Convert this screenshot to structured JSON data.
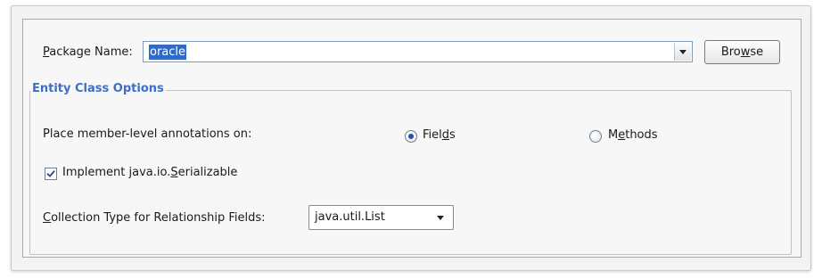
{
  "package": {
    "label_prefix": "",
    "label_accesskey": "P",
    "label_rest": "ackage Name:",
    "value": "oracle",
    "browse_label_prefix": "Bro",
    "browse_label_accesskey": "w",
    "browse_label_rest": "se"
  },
  "entity_options": {
    "legend": "Entity Class Options",
    "annotations_label": "Place member-level annotations on:",
    "radio_fields": {
      "prefix": "Fiel",
      "accesskey": "d",
      "rest": "s",
      "selected": true
    },
    "radio_methods": {
      "prefix": "M",
      "accesskey": "e",
      "rest": "thods",
      "selected": false
    },
    "serializable": {
      "prefix": "Implement java.io.",
      "accesskey": "S",
      "rest": "erializable",
      "checked": true
    },
    "collection_label": {
      "prefix": "",
      "accesskey": "C",
      "rest": "ollection Type for Relationship Fields:"
    },
    "collection_value": "java.util.List"
  },
  "colors": {
    "legend": "#3d6fc4",
    "selection": "#316ac5",
    "check": "#2a4e9b"
  }
}
